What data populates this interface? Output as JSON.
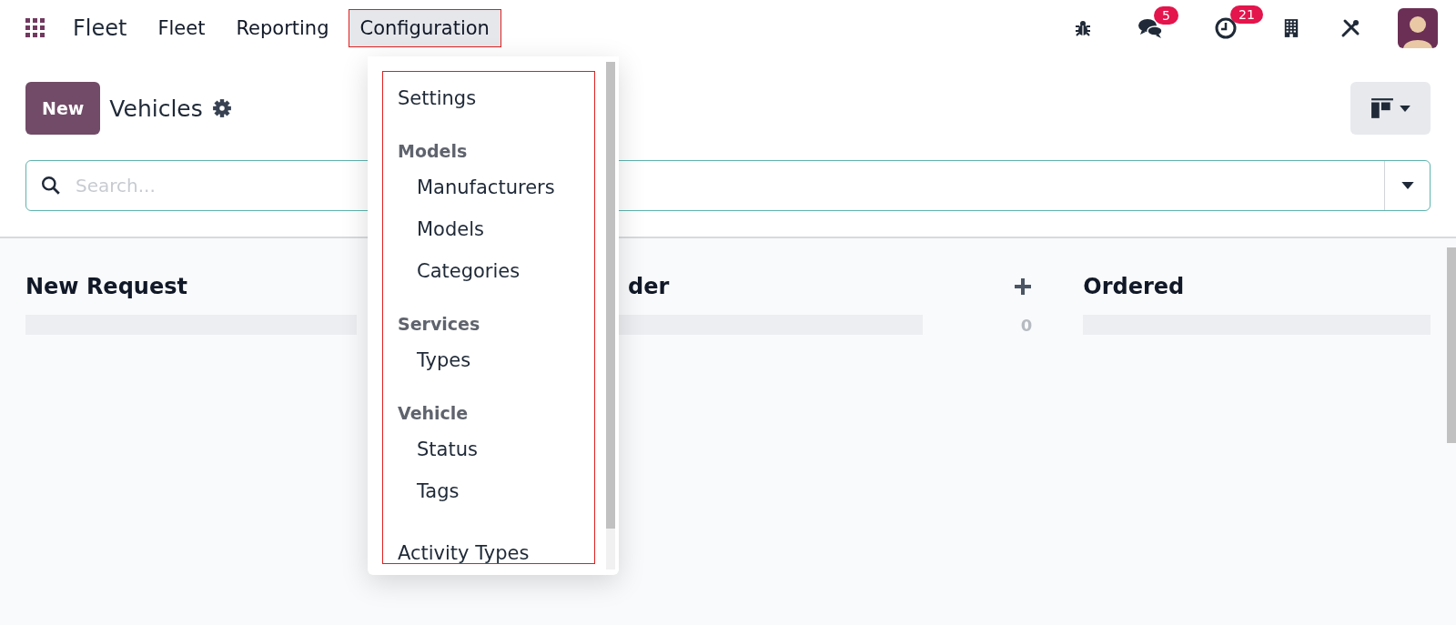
{
  "navbar": {
    "app_name": "Fleet",
    "menus": [
      {
        "label": "Fleet",
        "selected": false
      },
      {
        "label": "Reporting",
        "selected": false
      },
      {
        "label": "Configuration",
        "selected": true
      }
    ],
    "badges": {
      "messages": "5",
      "activities": "21"
    }
  },
  "control_panel": {
    "new_button": "New",
    "title": "Vehicles"
  },
  "search": {
    "placeholder": "Search..."
  },
  "dropdown": {
    "items": [
      {
        "kind": "item",
        "label": "Settings"
      },
      {
        "kind": "header",
        "label": "Models"
      },
      {
        "kind": "subitem",
        "label": "Manufacturers"
      },
      {
        "kind": "subitem",
        "label": "Models"
      },
      {
        "kind": "subitem",
        "label": "Categories"
      },
      {
        "kind": "header",
        "label": "Services"
      },
      {
        "kind": "subitem",
        "label": "Types"
      },
      {
        "kind": "header",
        "label": "Vehicle"
      },
      {
        "kind": "subitem",
        "label": "Status"
      },
      {
        "kind": "subitem",
        "label": "Tags"
      },
      {
        "kind": "item",
        "label": "Activity Types"
      }
    ]
  },
  "kanban": {
    "columns": [
      {
        "title": "New Request",
        "level": 0
      },
      {
        "title": "der",
        "count": "0",
        "level": 0
      },
      {
        "title": "Ordered",
        "level": 0
      }
    ]
  }
}
